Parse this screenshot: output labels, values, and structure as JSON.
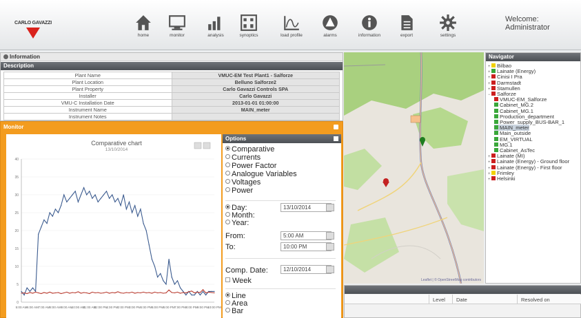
{
  "topbar": {
    "logo_text": "CARLO GAVAZZI",
    "welcome": "Welcome: Administrator",
    "nav": [
      {
        "label": "home",
        "icon": "home-icon"
      },
      {
        "label": "monitor",
        "icon": "monitor-icon"
      },
      {
        "label": "analysis",
        "icon": "analysis-icon"
      },
      {
        "label": "synoptics",
        "icon": "synoptics-icon"
      },
      {
        "label": "load profile",
        "icon": "load-profile-icon"
      },
      {
        "label": "alarms",
        "icon": "alarm-icon"
      },
      {
        "label": "information",
        "icon": "information-icon"
      },
      {
        "label": "export",
        "icon": "export-icon"
      },
      {
        "label": "settings",
        "icon": "gear-icon"
      }
    ]
  },
  "information": {
    "title": "Information",
    "description_title": "Description",
    "rows": [
      {
        "label": "Plant Name",
        "value": "VMUC-EM Test Plant1 - Salforze"
      },
      {
        "label": "Plant Location",
        "value": "Belluno Salforze2"
      },
      {
        "label": "Plant Property",
        "value": "Carlo Gavazzi Controls SPA"
      },
      {
        "label": "Installer",
        "value": "Carlo Gavazzi"
      },
      {
        "label": "VMU-C Installation Date",
        "value": "2013-01-01 01:00:00"
      },
      {
        "label": "Instrument Name",
        "value": "MAIN_meter"
      },
      {
        "label": "Instrument Notes",
        "value": ""
      }
    ]
  },
  "monitor": {
    "title": "Monitor",
    "chart_title": "Comparative chart",
    "chart_subtitle": "13/10/2014"
  },
  "chart_data": {
    "type": "line",
    "title": "Comparative chart",
    "subtitle": "13/10/2014",
    "xlabel": "",
    "ylabel": "",
    "ylim": [
      0,
      40
    ],
    "y_ticks": [
      "0",
      "5",
      "10",
      "15",
      "20",
      "25",
      "30",
      "35",
      "40"
    ],
    "x_ticks": [
      "5:00 AM",
      "6:00 AM",
      "7:00 AM",
      "8:00 AM",
      "9:00 AM",
      "10:00 AM",
      "11:00 AM",
      "12:00 PM",
      "1:00 PM",
      "2:00 PM",
      "3:00 PM",
      "4:00 PM",
      "5:00 PM",
      "6:00 PM",
      "7:00 PM",
      "8:00 PM",
      "9:00 PM",
      "10:00 PM"
    ],
    "x": [
      5,
      5.25,
      5.5,
      5.75,
      6,
      6.25,
      6.5,
      6.75,
      7,
      7.25,
      7.5,
      7.75,
      8,
      8.25,
      8.5,
      8.75,
      9,
      9.25,
      9.5,
      9.75,
      10,
      10.25,
      10.5,
      10.75,
      11,
      11.25,
      11.5,
      11.75,
      12,
      12.25,
      12.5,
      12.75,
      13,
      13.25,
      13.5,
      13.75,
      14,
      14.25,
      14.5,
      14.75,
      15,
      15.25,
      15.5,
      15.75,
      16,
      16.25,
      16.5,
      16.75,
      17,
      17.25,
      17.5,
      17.75,
      18,
      18.25,
      18.5,
      18.75,
      19,
      19.25,
      19.5,
      19.75,
      20,
      20.25,
      20.5,
      20.75,
      21,
      21.25,
      21.5,
      21.75,
      22
    ],
    "series": [
      {
        "color": "#3b5b8f",
        "values": [
          3,
          2,
          4,
          3,
          4,
          3,
          19,
          21,
          23,
          22,
          25,
          24,
          26,
          25,
          27,
          30,
          28,
          29,
          30,
          31,
          28,
          30,
          32,
          30,
          31,
          29,
          30,
          28,
          29,
          30,
          31,
          29,
          30,
          28,
          29,
          27,
          30,
          26,
          28,
          25,
          27,
          24,
          26,
          22,
          20,
          16,
          12,
          10,
          7,
          8,
          6,
          5,
          12,
          7,
          5,
          6,
          4,
          3,
          2,
          3,
          2,
          2,
          3,
          2,
          3,
          2,
          3,
          3,
          3
        ]
      },
      {
        "color": "#b83a2e",
        "values": [
          2.5,
          2.6,
          2.4,
          2.7,
          2.5,
          2.8,
          2.6,
          2.4,
          2.7,
          2.5,
          2.8,
          2.5,
          2.6,
          2.7,
          2.4,
          2.6,
          2.8,
          2.5,
          2.7,
          2.6,
          2.9,
          2.5,
          2.7,
          2.6,
          2.4,
          2.8,
          2.6,
          2.7,
          2.5,
          2.6,
          2.8,
          2.5,
          2.7,
          2.6,
          2.9,
          2.6,
          2.5,
          2.7,
          2.6,
          2.8,
          2.5,
          2.7,
          2.6,
          2.8,
          2.6,
          2.7,
          2.5,
          2.8,
          2.6,
          2.7,
          2.5,
          2.6,
          3.4,
          2.7,
          2.6,
          2.8,
          2.5,
          2.7,
          2.6,
          2.9,
          3.1,
          2.6,
          2.8,
          2.7,
          3.5,
          2.6,
          2.8,
          2.7,
          2.6
        ]
      }
    ]
  },
  "options": {
    "title": "Options",
    "modes": [
      {
        "label": "Comparative",
        "selected": true
      },
      {
        "label": "Currents",
        "selected": false
      },
      {
        "label": "Power Factor",
        "selected": false
      },
      {
        "label": "Analogue Variables",
        "selected": false
      },
      {
        "label": "Voltages",
        "selected": false
      },
      {
        "label": "Power",
        "selected": false
      }
    ],
    "periods": [
      {
        "label": "Day:",
        "selected": true
      },
      {
        "label": "Month:",
        "selected": false
      },
      {
        "label": "Year:",
        "selected": false
      }
    ],
    "date_value": "13/10/2014",
    "from_label": "From:",
    "from_value": "5:00 AM",
    "to_label": "To:",
    "to_value": "10:00 PM",
    "comp_date_label": "Comp. Date:",
    "comp_date_value": "12/10/2014",
    "week_label": "Week",
    "chart_types": [
      {
        "label": "Line",
        "selected": true
      },
      {
        "label": "Area",
        "selected": false
      },
      {
        "label": "Bar",
        "selected": false
      }
    ]
  },
  "map": {
    "credit": "Leaflet | © OpenStreetMap contributors"
  },
  "navigator": {
    "title": "Navigator",
    "items": [
      {
        "label": "Bilbao",
        "color": "#f2d100",
        "indent": 0,
        "pm": "+"
      },
      {
        "label": "Lainate (Energy)",
        "color": "#3aa73a",
        "indent": 0,
        "pm": "+"
      },
      {
        "label": "Cinisi I Pra",
        "color": "#cc1f1f",
        "indent": 0,
        "pm": "+"
      },
      {
        "label": "Darmstadt",
        "color": "#cc1f1f",
        "indent": 0,
        "pm": "+"
      },
      {
        "label": "Stamullen",
        "color": "#cc1f1f",
        "indent": 0,
        "pm": "+"
      },
      {
        "label": "Salforze",
        "color": "#cc1f1f",
        "indent": 0,
        "pm": "-"
      },
      {
        "label": "VMUC-EM_Salforze",
        "color": "#cc1f1f",
        "indent": 1,
        "pm": ""
      },
      {
        "label": "Cabinet_MG.2",
        "color": "#3aa73a",
        "indent": 1,
        "pm": ""
      },
      {
        "label": "Cabinet_MG.1",
        "color": "#3aa73a",
        "indent": 1,
        "pm": ""
      },
      {
        "label": "Production_department",
        "color": "#3aa73a",
        "indent": 1,
        "pm": ""
      },
      {
        "label": "Power_supply_BUS-BAR_1",
        "color": "#3aa73a",
        "indent": 1,
        "pm": ""
      },
      {
        "label": "MAIN_meter",
        "color": "#3aa73a",
        "indent": 1,
        "pm": "",
        "selected": true
      },
      {
        "label": "Main_outside",
        "color": "#3aa73a",
        "indent": 1,
        "pm": ""
      },
      {
        "label": "EM_VIRTUAL",
        "color": "#3aa73a",
        "indent": 1,
        "pm": ""
      },
      {
        "label": "MG.1",
        "color": "#3aa73a",
        "indent": 1,
        "pm": ""
      },
      {
        "label": "Cabinet_AsTec",
        "color": "#3aa73a",
        "indent": 1,
        "pm": ""
      },
      {
        "label": "Lainate (MI)",
        "color": "#cc1f1f",
        "indent": 0,
        "pm": "+"
      },
      {
        "label": "Lainate (Energy) - Ground floor",
        "color": "#cc1f1f",
        "indent": 0,
        "pm": "+"
      },
      {
        "label": "Lainate (Energy) - First floor",
        "color": "#cc1f1f",
        "indent": 0,
        "pm": "+"
      },
      {
        "label": "Frimley",
        "color": "#f2d100",
        "indent": 0,
        "pm": "+"
      },
      {
        "label": "Helsinki",
        "color": "#cc1f1f",
        "indent": 0,
        "pm": "+"
      }
    ]
  },
  "alarms": {
    "columns": [
      "Level",
      "Date",
      "Resolved on"
    ]
  }
}
